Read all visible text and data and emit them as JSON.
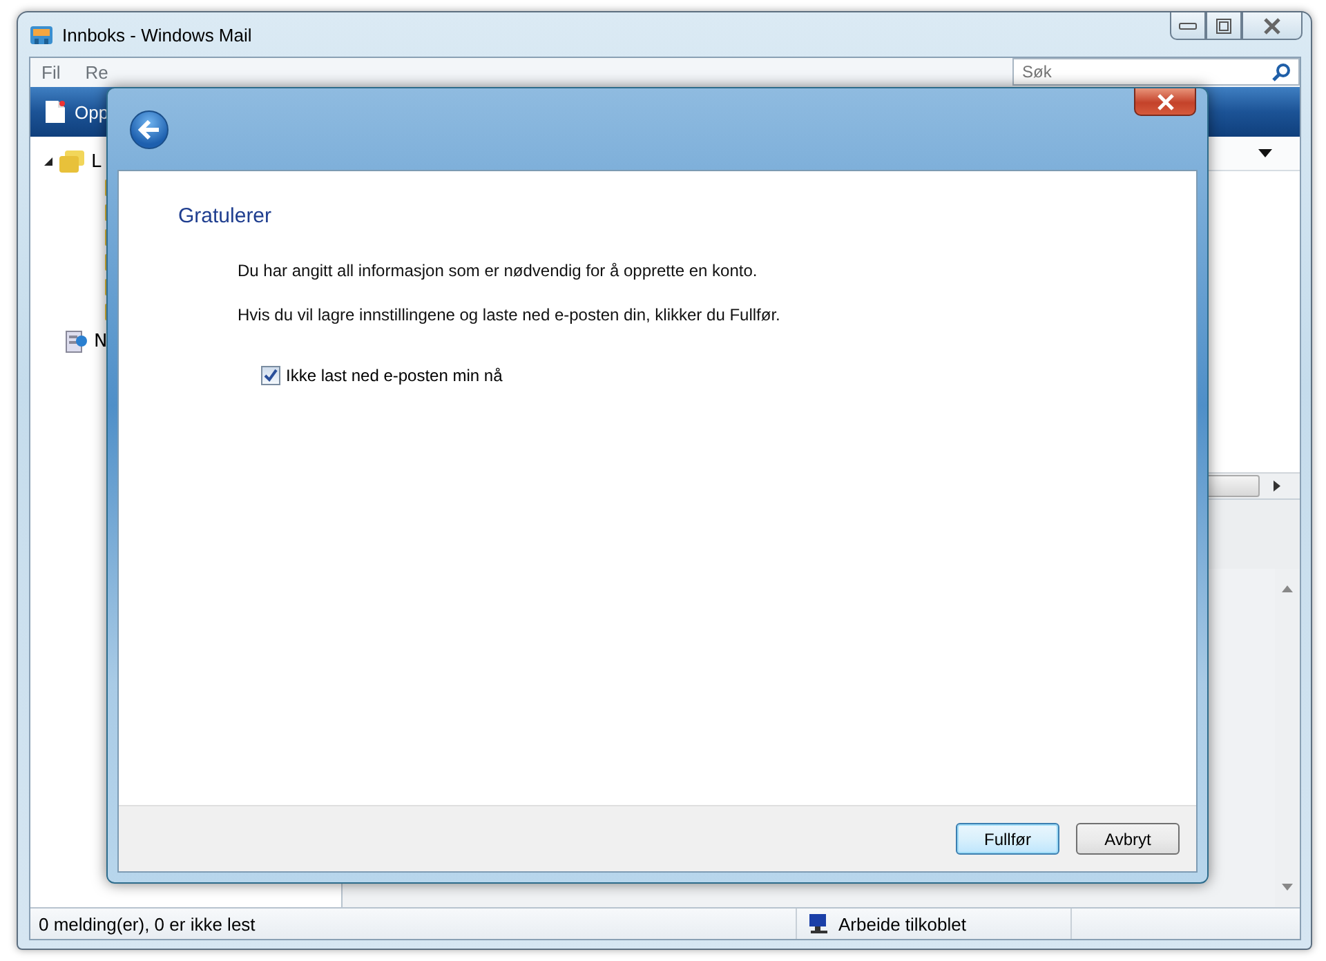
{
  "window": {
    "title": "Innboks - Windows Mail"
  },
  "menu": [
    {
      "label": "Fil"
    },
    {
      "label": "Re"
    }
  ],
  "search": {
    "placeholder": "Søk"
  },
  "toolbar": [
    {
      "label": "Opp"
    }
  ],
  "tree": [
    {
      "label": "L",
      "expanded": true,
      "kind": "folders"
    },
    {
      "label": "N",
      "kind": "contacts"
    }
  ],
  "status_bar": {
    "messages": "0 melding(er), 0 er ikke lest",
    "connection": "Arbeide tilkoblet"
  },
  "dialog": {
    "heading": "Gratulerer",
    "paragraphs": [
      "Du har angitt all informasjon som er nødvendig for å opprette en konto.",
      "Hvis du vil lagre innstillingene og laste ned e-posten din, klikker du Fullfør."
    ],
    "checkbox": {
      "label": "Ikke last ned e-posten min nå",
      "checked": true
    },
    "buttons": [
      {
        "label": "Fullfør",
        "default": true
      },
      {
        "label": "Avbryt",
        "default": false
      }
    ]
  }
}
